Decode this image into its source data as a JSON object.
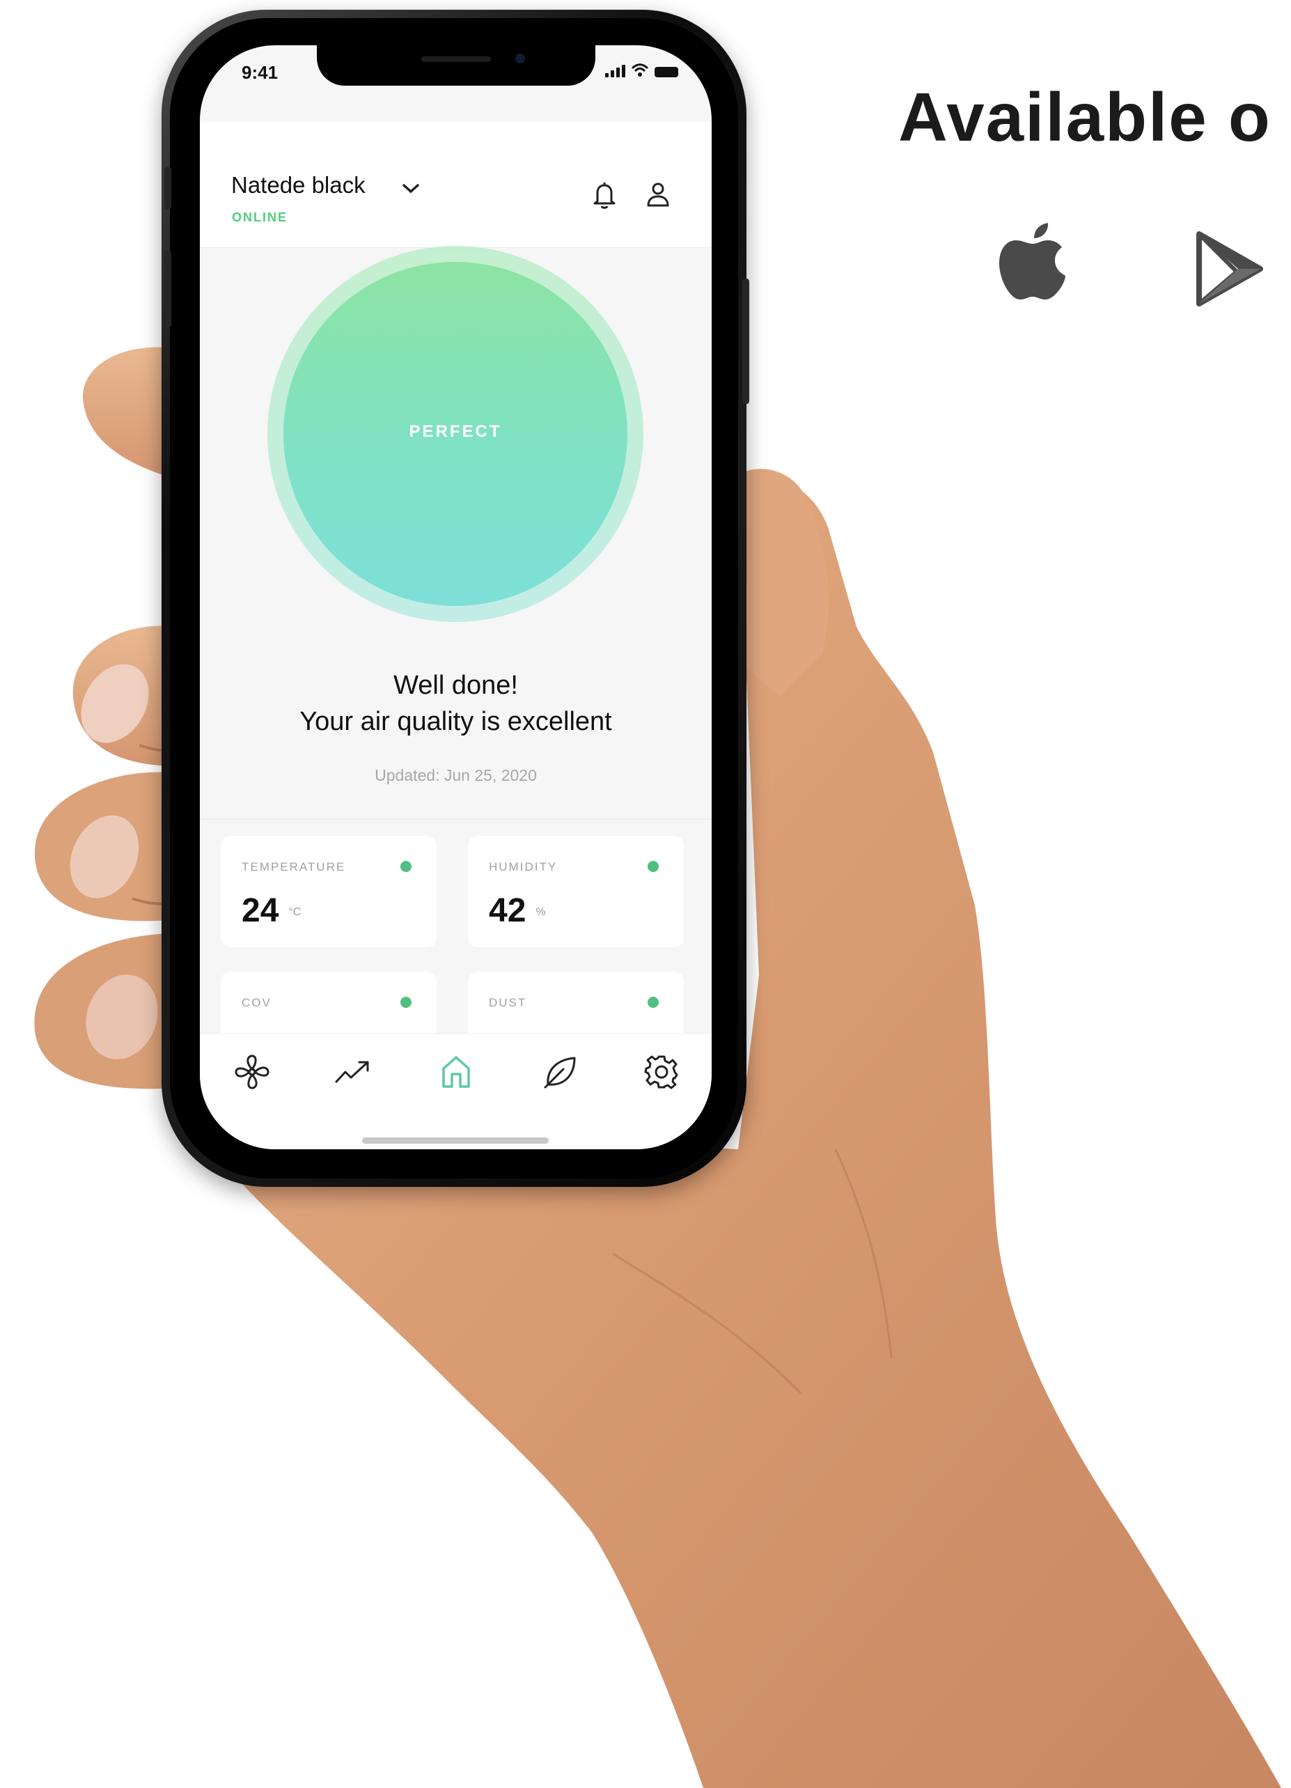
{
  "promo": {
    "heading": "Available o"
  },
  "status_bar": {
    "time": "9:41"
  },
  "header": {
    "device_name": "Natede black",
    "status": "ONLINE"
  },
  "gauge": {
    "label": "PERFECT"
  },
  "summary": {
    "line1": "Well done!",
    "line2": "Your air quality is excellent",
    "updated": "Updated: Jun 25, 2020"
  },
  "metrics": [
    {
      "label": "TEMPERATURE",
      "value": "24",
      "unit": "°C"
    },
    {
      "label": "HUMIDITY",
      "value": "42",
      "unit": "%"
    },
    {
      "label": "COV",
      "value": "",
      "unit": ""
    },
    {
      "label": "DUST",
      "value": "",
      "unit": ""
    }
  ],
  "tabs": [
    "fan-icon",
    "trend-icon",
    "home-icon",
    "leaf-icon",
    "gear-icon"
  ],
  "colors": {
    "accent": "#4fcf7e",
    "active_tab": "#5fc9a3",
    "gauge_top": "#8de3a3",
    "gauge_bottom": "#7ddfd8"
  }
}
